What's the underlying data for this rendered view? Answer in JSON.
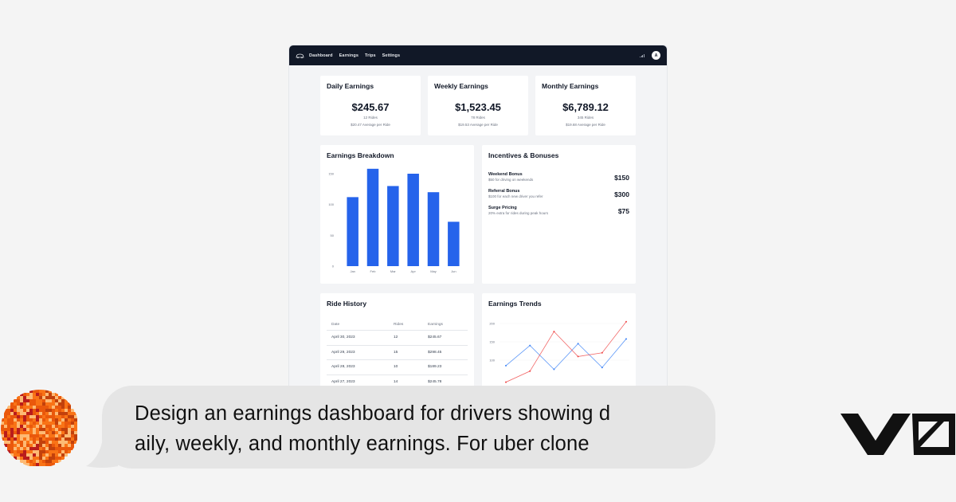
{
  "navbar": {
    "links": [
      "Dashboard",
      "Earnings",
      "Trips",
      "Settings"
    ],
    "avatar_initial": "A"
  },
  "summary": [
    {
      "title": "Daily Earnings",
      "value": "$245.67",
      "rides": "12 Rides",
      "average": "$20.47 Average per Ride"
    },
    {
      "title": "Weekly Earnings",
      "value": "$1,523.45",
      "rides": "78 Rides",
      "average": "$19.53 Average per Ride"
    },
    {
      "title": "Monthly Earnings",
      "value": "$6,789.12",
      "rides": "345 Rides",
      "average": "$19.68 Average per Ride"
    }
  ],
  "breakdown": {
    "title": "Earnings Breakdown"
  },
  "incentives": {
    "title": "Incentives & Bonuses",
    "items": [
      {
        "name": "Weekend Bonus",
        "desc": "$50 for driving on weekends",
        "amount": "$150"
      },
      {
        "name": "Referral Bonus",
        "desc": "$100 for each new driver you refer",
        "amount": "$300"
      },
      {
        "name": "Surge Pricing",
        "desc": "20% extra for rides during peak hours",
        "amount": "$75"
      }
    ]
  },
  "ride_history": {
    "title": "Ride History",
    "columns": [
      "Date",
      "Rides",
      "Earnings"
    ],
    "rows": [
      [
        "April 30, 2023",
        "12",
        "$245.67"
      ],
      [
        "April 29, 2023",
        "15",
        "$298.45"
      ],
      [
        "April 28, 2023",
        "10",
        "$189.23"
      ],
      [
        "April 27, 2023",
        "14",
        "$245.78"
      ]
    ]
  },
  "trends": {
    "title": "Earnings Trends"
  },
  "chart_data": [
    {
      "type": "bar",
      "title": "Earnings Breakdown",
      "categories": [
        "Jan",
        "Feb",
        "Mar",
        "Apr",
        "May",
        "Jun"
      ],
      "values": [
        112,
        158,
        130,
        150,
        120,
        72
      ],
      "ylim": [
        0,
        150
      ],
      "yticks": [
        "0",
        "50",
        "100",
        "150"
      ],
      "color": "#2563eb"
    },
    {
      "type": "line",
      "title": "Earnings Trends",
      "yticks": [
        "200",
        "150",
        "100"
      ],
      "ylim": [
        0,
        200
      ],
      "series": [
        {
          "color": "#3b82f6",
          "values": [
            85,
            140,
            75,
            145,
            80,
            158
          ]
        },
        {
          "color": "#ef4444",
          "values": [
            40,
            70,
            178,
            110,
            120,
            205
          ]
        }
      ]
    }
  ],
  "prompt": {
    "line1": "Design an earnings dashboard for drivers showing d",
    "line2": "aily, weekly, and monthly earnings. For uber clone"
  },
  "colors": {
    "navbar": "#111827",
    "bar": "#2563eb",
    "bubble": "#e5e5e5",
    "avatar_orange": "#f97316"
  }
}
